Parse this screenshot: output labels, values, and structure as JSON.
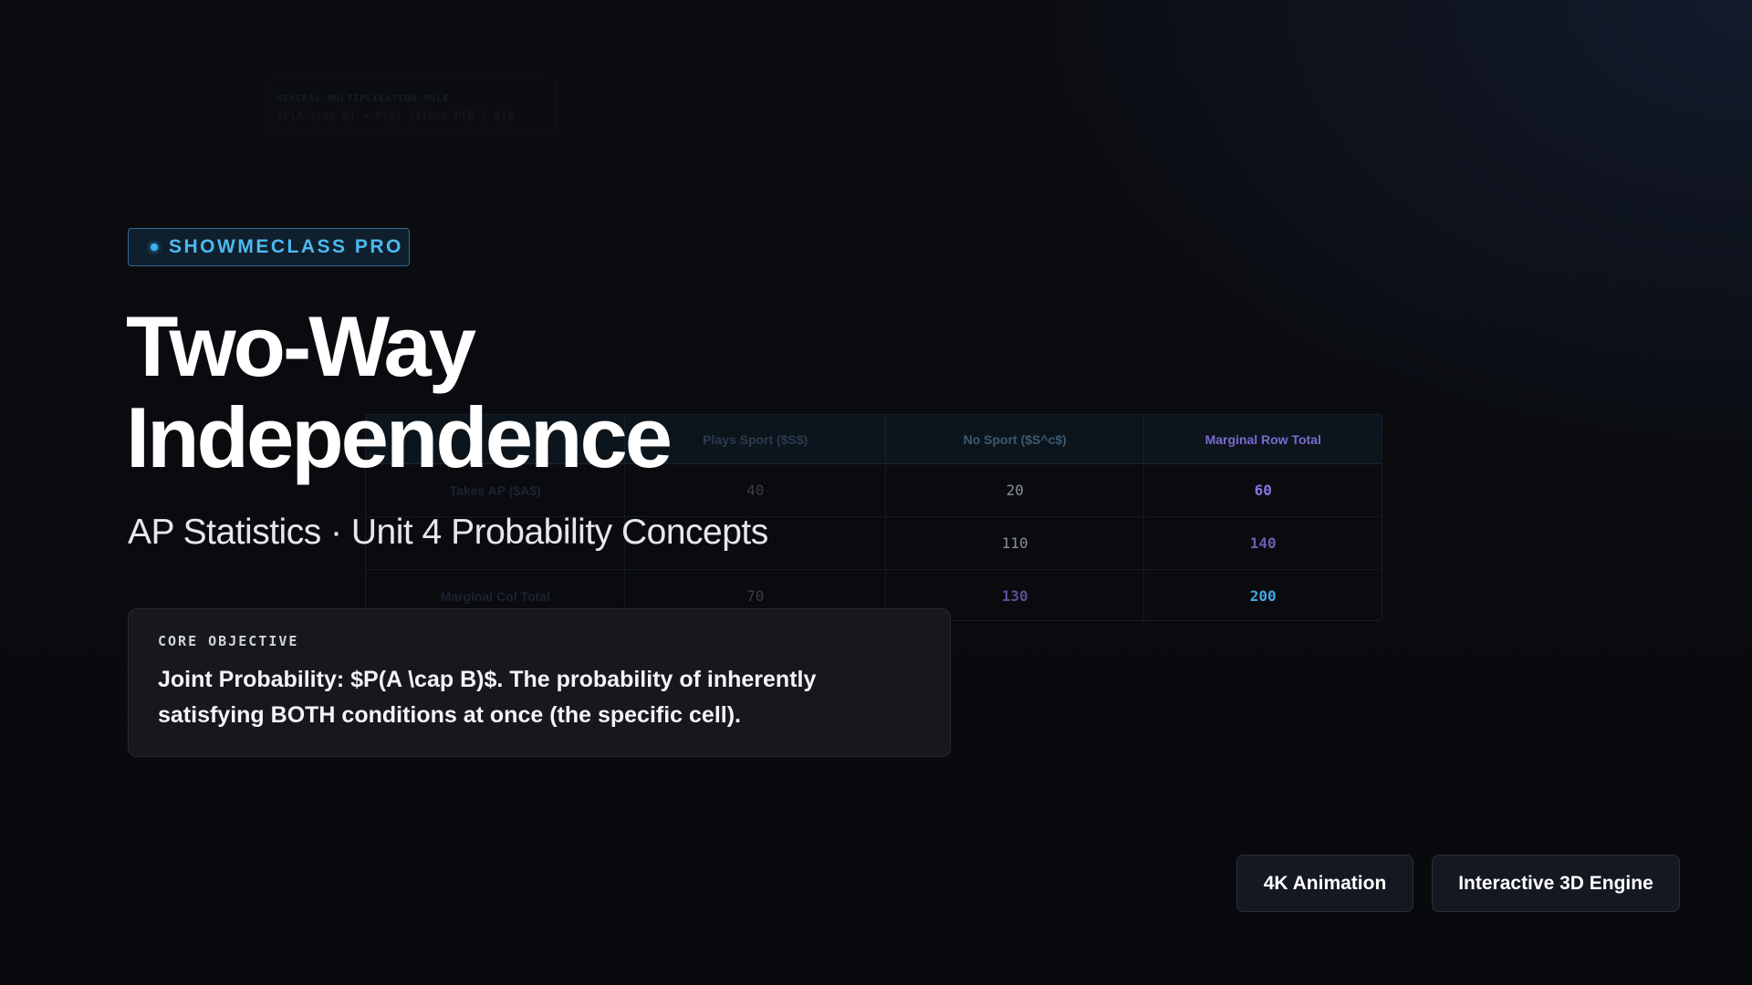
{
  "formula": {
    "label": "General Multiplication Rule",
    "expression": "$P(A \\cap B) = P(A) \\times P(B | A)$"
  },
  "badge": {
    "text": "SHOWMECLASS PRO"
  },
  "title": {
    "line1": "Two-Way",
    "line2": "Independence"
  },
  "subtitle": "AP Statistics · Unit 4 Probability Concepts",
  "objective": {
    "label": "CORE OBJECTIVE",
    "text": "Joint Probability: $P(A \\cap B)$. The probability of inherently satisfying BOTH conditions at once (the specific cell)."
  },
  "table": {
    "headers": [
      "",
      "Plays Sport ($S$)",
      "No Sport ($S^c$)",
      "Marginal Row Total"
    ],
    "rows": [
      {
        "label": "Takes AP ($A$)",
        "values": [
          "40",
          "20",
          "60"
        ]
      },
      {
        "label": "",
        "values": [
          "",
          "110",
          "140"
        ]
      },
      {
        "label": "Marginal Col Total",
        "values": [
          "70",
          "130",
          "200"
        ]
      }
    ]
  },
  "tags": [
    "4K Animation",
    "Interactive 3D Engine"
  ]
}
